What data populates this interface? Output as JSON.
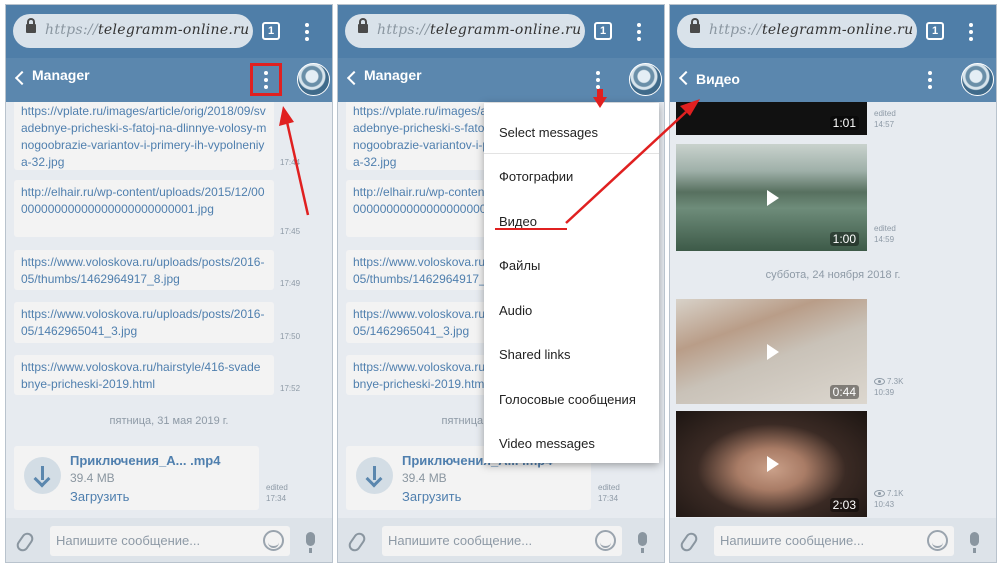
{
  "colors": {
    "header": "#5b87ae",
    "urlbar": "#4f7ea8",
    "link": "#4f7fae",
    "annotation": "#e02020",
    "chat_bg": "#e7ebf0"
  },
  "browser": {
    "url_prefix": "https://",
    "url_domain": "telegramm-online.ru",
    "tab_count": "1"
  },
  "chat": {
    "title": "Manager",
    "messages": [
      {
        "text": "https://vplate.ru/images/article/orig/2018/09/svadebnye-pricheski-s-fatoj-na-dlinnye-volosy-mnogoobrazie-variantov-i-primery-ih-vypolneniya-32.jpg",
        "time": "17:44"
      },
      {
        "text": "http://elhair.ru/wp-content/uploads/2015/12/0000000000000000000000000001.jpg",
        "time": "17:45"
      },
      {
        "text": "https://www.voloskova.ru/uploads/posts/2016-05/thumbs/1462964917_8.jpg",
        "time": "17:49"
      },
      {
        "text": "https://www.voloskova.ru/uploads/posts/2016-05/1462965041_3.jpg",
        "time": "17:50"
      },
      {
        "text": "https://www.voloskova.ru/hairstyle/416-svadebnye-pricheski-2019.html",
        "time": "17:52"
      }
    ],
    "date_separator": "пятница, 31 мая 2019 г.",
    "file": {
      "name": "Приключения_А...  .mp4",
      "size": "39.4 MB",
      "download_label": "Загрузить",
      "edited": "edited",
      "time": "17:34"
    },
    "input_placeholder": "Напишите сообщение..."
  },
  "menu": {
    "items": [
      "Select messages",
      "Фотографии",
      "Видео",
      "Файлы",
      "Audio",
      "Shared links",
      "Голосовые сообщения",
      "Video messages"
    ]
  },
  "media": {
    "title": "Видео",
    "videos": [
      {
        "duration": "1:01",
        "edited": "edited",
        "time": "14:57"
      },
      {
        "duration": "1:00",
        "edited": "edited",
        "time": "14:59"
      },
      {
        "duration": "0:44",
        "views": "7.3K",
        "time": "10:39"
      },
      {
        "duration": "2:03",
        "views": "7.1K",
        "time": "10:43"
      }
    ],
    "date_separator": "суббота, 24 ноября 2018 г."
  }
}
